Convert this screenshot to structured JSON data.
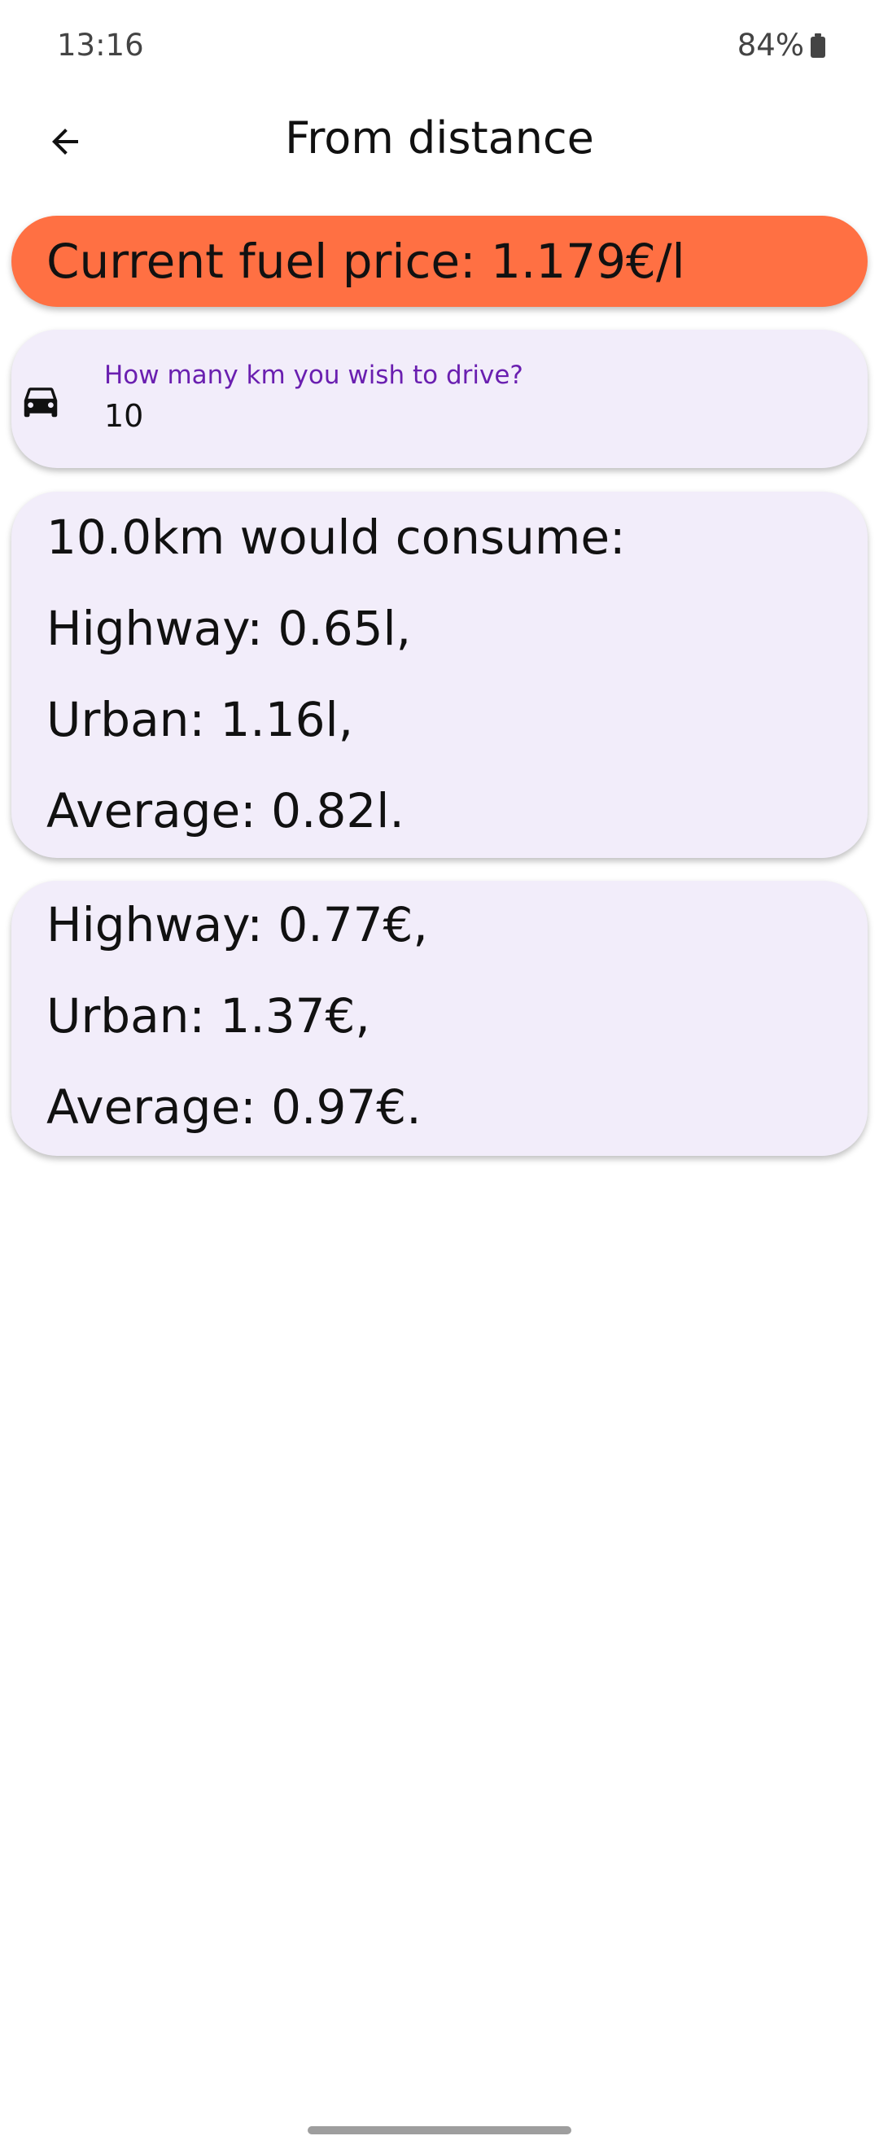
{
  "status_bar": {
    "time": "13:16",
    "battery": "84%"
  },
  "app_bar": {
    "title": "From distance",
    "back_icon": "arrow-back-icon"
  },
  "price_banner": {
    "text": "Current fuel price: 1.179€/l",
    "color": "#ff7043"
  },
  "distance_input": {
    "icon": "car-icon",
    "label": "How many km you wish to drive?",
    "value": "10"
  },
  "consumption": {
    "header": "10.0km would consume:",
    "highway": "Highway: 0.65l,",
    "urban": "Urban: 1.16l,",
    "average": "Average: 0.82l."
  },
  "cost": {
    "highway": "Highway: 0.77€,",
    "urban": "Urban: 1.37€,",
    "average": "Average: 0.97€."
  },
  "colors": {
    "card_background": "#f2edfa",
    "label_accent": "#6a1fb0"
  }
}
